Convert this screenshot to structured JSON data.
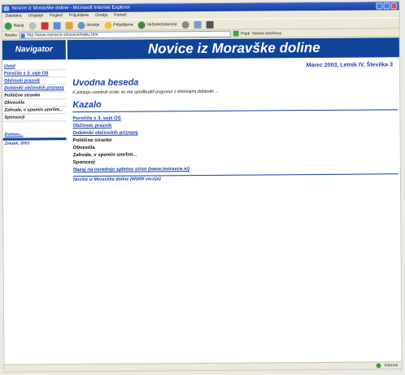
{
  "window": {
    "title": "Novice iz Moravške doline - Microsoft Internet Explorer"
  },
  "menu": [
    "Datoteka",
    "Urejanje",
    "Pogled",
    "Priljubljene",
    "Orodja",
    "Pomoč"
  ],
  "toolbar": {
    "back_label": "Nazaj",
    "search_label": "Iskanje",
    "favorites_label": "Priljubljene",
    "media_label": "Večpredstavnost"
  },
  "address": {
    "label": "Naslov",
    "url": "http://www.moravce.si/novice/index.htm",
    "go_label": "Pojdi",
    "extra": "Norton AntiVirus"
  },
  "nav": {
    "title": "Navigator",
    "items": [
      {
        "label": "Uvod",
        "link": true
      },
      {
        "label": "Poročilo s 3. seje OS",
        "link": true
      },
      {
        "label": "Občinski praznik",
        "link": true
      },
      {
        "label": "Dobitniki občinskih priznanj",
        "link": true
      },
      {
        "label": "Politične stranke",
        "link": false
      },
      {
        "label": "Obvestila",
        "link": false
      },
      {
        "label": "Zahvale, v spomin umrlim...",
        "link": false
      },
      {
        "label": "Sponzorji",
        "link": false
      }
    ],
    "domov": "Domov...",
    "date": "Zvezek, 2003"
  },
  "banner": {
    "title": "Novice iz Moravške doline"
  },
  "main": {
    "issue": "Marec 2003, Letnik IV, Številka 3",
    "uvod_heading": "Uvodna beseda",
    "uvod_text": "K pisanju uvodnih vrstic so me spodbudili pogovori z letošnjimi dobitniki ...",
    "kazalo_heading": "Kazalo",
    "toc": [
      {
        "label": "Poročilo s 3. seje OS",
        "link": true
      },
      {
        "label": "Občinski praznik",
        "link": true
      },
      {
        "label": "Dobitniki občinskih priznanj",
        "link": true
      },
      {
        "label": "Politične stranke",
        "link": false
      },
      {
        "label": "Obvestila",
        "link": false
      },
      {
        "label": "Zahvale, v spomin umrlim...",
        "link": false
      },
      {
        "label": "Sponzorji",
        "link": false
      }
    ],
    "back_link": "Nazaj na osrednjo spletno stran (www.moravce.si)",
    "footer": "Novice iz Moravške doline (WWW verzija)"
  },
  "status": {
    "zone": "Internet"
  }
}
